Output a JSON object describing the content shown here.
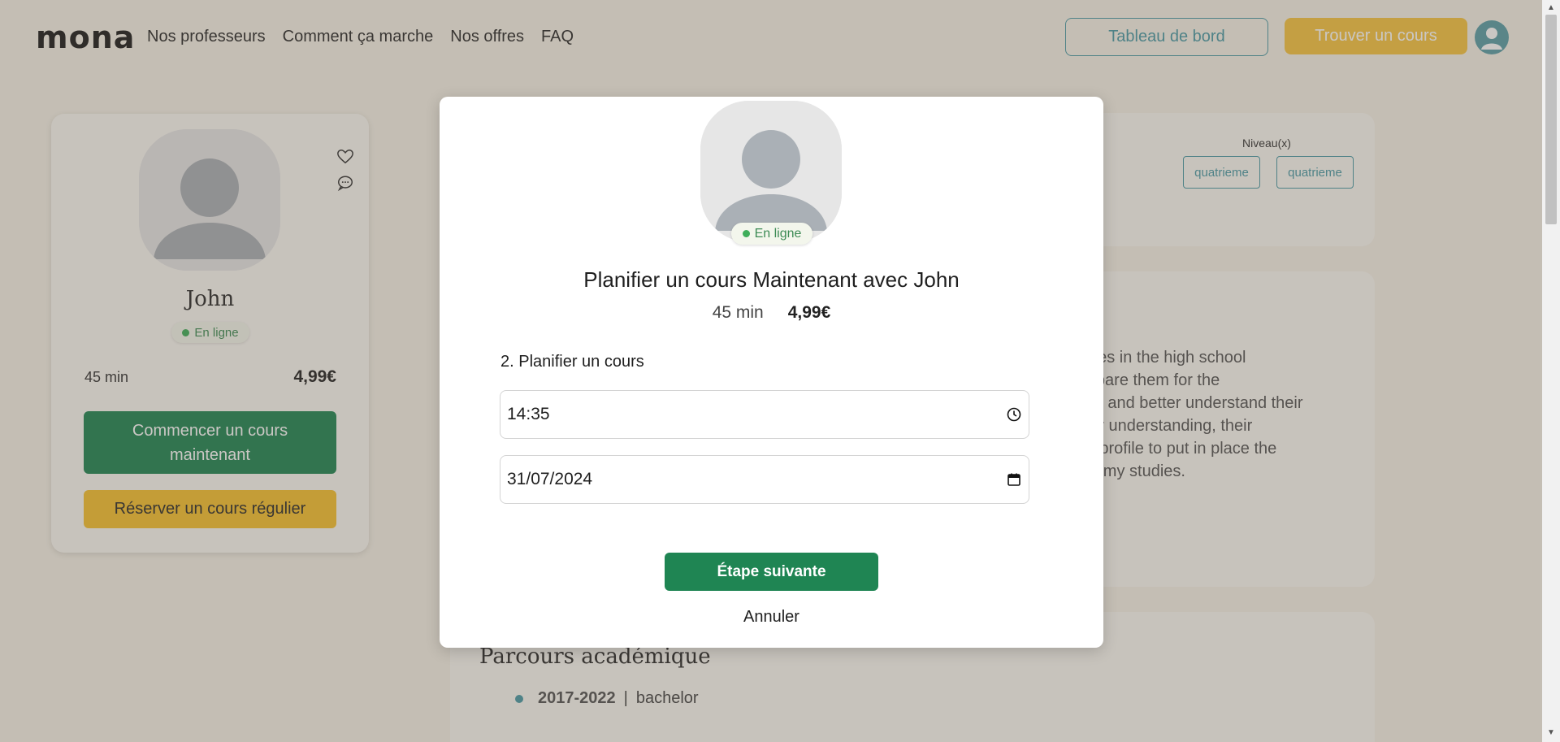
{
  "header": {
    "logo": "mona",
    "nav": [
      "Nos professeurs",
      "Comment ça marche",
      "Nos offres",
      "FAQ"
    ],
    "dashboard_label": "Tableau de bord",
    "find_course_label": "Trouver un cours"
  },
  "profile": {
    "name": "John",
    "status": "En ligne",
    "duration": "45 min",
    "price": "4,99€",
    "start_now_label": "Commencer un cours maintenant",
    "book_regular_label": "Réserver un cours régulier"
  },
  "levels": {
    "label": "Niveau(x)",
    "chips": [
      "quatrieme",
      "quatrieme"
    ]
  },
  "bio": {
    "lines": [
      "asses in the high school",
      " prepare them for the",
      "ents and better understand their",
      "their understanding, their",
      "ent profile to put in place the",
      "lete my studies."
    ]
  },
  "academic": {
    "title": "Parcours académique",
    "items": [
      {
        "years": "2017-2022",
        "separator": "|",
        "degree": "bachelor"
      }
    ]
  },
  "modal": {
    "status": "En ligne",
    "title": "Planifier un cours Maintenant avec John",
    "duration": "45 min",
    "price": "4,99€",
    "step_label": "2. Planifier un cours",
    "time_value": "14:35",
    "date_value": "31/07/2024",
    "next_label": "Étape suivante",
    "cancel_label": "Annuler"
  },
  "colors": {
    "green": "#1f8553",
    "yellow": "#f6c230",
    "teal": "#4a9aa6",
    "background": "#f6f2e8"
  }
}
